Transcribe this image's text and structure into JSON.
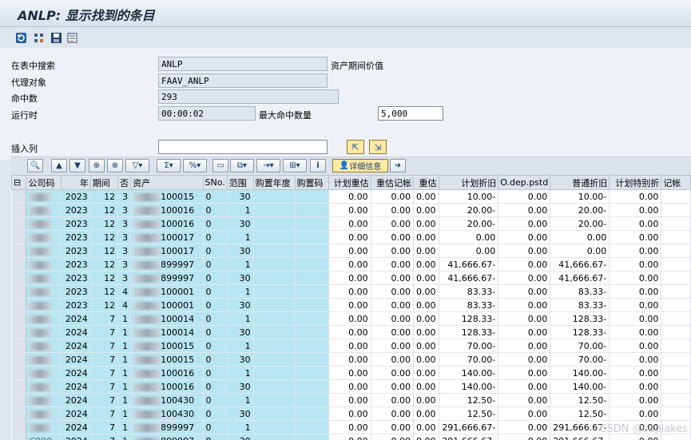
{
  "window": {
    "title": "ANLP: 显示找到的条目"
  },
  "toolbar": {
    "icons": [
      "refresh-icon",
      "settings-icon",
      "save-icon",
      "detail-icon"
    ]
  },
  "selection": {
    "search_table_label": "在表中搜索",
    "search_table_value": "ANLP",
    "search_table_desc": "资产期间价值",
    "proxy_label": "代理对象",
    "proxy_value": "FAAV_ANLP",
    "hits_label": "命中数",
    "hits_value": "293",
    "runtime_label": "运行时",
    "runtime_value": "00:00:02",
    "max_hits_label": "最大命中数量",
    "max_hits_value": "5,000",
    "insert_col_label": "插入列",
    "insert_col_value": ""
  },
  "alv_toolbar": {
    "detail_label": "详细信息"
  },
  "grid": {
    "headers": [
      "公司码",
      "年",
      "期间",
      "否",
      "资产",
      "SNo.",
      "范围",
      "购置年度",
      "购置码",
      "计划重估",
      "重估记帐",
      "重估",
      "计划折旧",
      "O.dep.pstd",
      "普通折旧",
      "计划特别折",
      "记帐"
    ],
    "rows": [
      [
        "",
        "2023",
        "12",
        "3",
        "100015",
        "0",
        "30",
        "",
        "",
        "0.00",
        "0.00",
        "0.00",
        "10.00-",
        "0.00",
        "10.00-",
        "0.00"
      ],
      [
        "",
        "2023",
        "12",
        "3",
        "100016",
        "0",
        "1",
        "",
        "",
        "0.00",
        "0.00",
        "0.00",
        "20.00-",
        "0.00",
        "20.00-",
        "0.00"
      ],
      [
        "",
        "2023",
        "12",
        "3",
        "100016",
        "0",
        "30",
        "",
        "",
        "0.00",
        "0.00",
        "0.00",
        "20.00-",
        "0.00",
        "20.00-",
        "0.00"
      ],
      [
        "",
        "2023",
        "12",
        "3",
        "100017",
        "0",
        "1",
        "",
        "",
        "0.00",
        "0.00",
        "0.00",
        "0.00",
        "0.00",
        "0.00",
        "0.00"
      ],
      [
        "",
        "2023",
        "12",
        "3",
        "100017",
        "0",
        "30",
        "",
        "",
        "0.00",
        "0.00",
        "0.00",
        "0.00",
        "0.00",
        "0.00",
        "0.00"
      ],
      [
        "",
        "2023",
        "12",
        "3",
        "899997",
        "0",
        "1",
        "",
        "",
        "0.00",
        "0.00",
        "0.00",
        "41,666.67-",
        "0.00",
        "41,666.67-",
        "0.00"
      ],
      [
        "",
        "2023",
        "12",
        "3",
        "899997",
        "0",
        "30",
        "",
        "",
        "0.00",
        "0.00",
        "0.00",
        "41,666.67-",
        "0.00",
        "41,666.67-",
        "0.00"
      ],
      [
        "",
        "2023",
        "12",
        "4",
        "100001",
        "0",
        "1",
        "",
        "",
        "0.00",
        "0.00",
        "0.00",
        "83.33-",
        "0.00",
        "83.33-",
        "0.00"
      ],
      [
        "",
        "2023",
        "12",
        "4",
        "100001",
        "0",
        "30",
        "",
        "",
        "0.00",
        "0.00",
        "0.00",
        "83.33-",
        "0.00",
        "83.33-",
        "0.00"
      ],
      [
        "",
        "2024",
        "7",
        "1",
        "100014",
        "0",
        "1",
        "",
        "",
        "0.00",
        "0.00",
        "0.00",
        "128.33-",
        "0.00",
        "128.33-",
        "0.00"
      ],
      [
        "",
        "2024",
        "7",
        "1",
        "100014",
        "0",
        "30",
        "",
        "",
        "0.00",
        "0.00",
        "0.00",
        "128.33-",
        "0.00",
        "128.33-",
        "0.00"
      ],
      [
        "",
        "2024",
        "7",
        "1",
        "100015",
        "0",
        "1",
        "",
        "",
        "0.00",
        "0.00",
        "0.00",
        "70.00-",
        "0.00",
        "70.00-",
        "0.00"
      ],
      [
        "",
        "2024",
        "7",
        "1",
        "100015",
        "0",
        "30",
        "",
        "",
        "0.00",
        "0.00",
        "0.00",
        "70.00-",
        "0.00",
        "70.00-",
        "0.00"
      ],
      [
        "",
        "2024",
        "7",
        "1",
        "100016",
        "0",
        "1",
        "",
        "",
        "0.00",
        "0.00",
        "0.00",
        "140.00-",
        "0.00",
        "140.00-",
        "0.00"
      ],
      [
        "",
        "2024",
        "7",
        "1",
        "100016",
        "0",
        "30",
        "",
        "",
        "0.00",
        "0.00",
        "0.00",
        "140.00-",
        "0.00",
        "140.00-",
        "0.00"
      ],
      [
        "",
        "2024",
        "7",
        "1",
        "100430",
        "0",
        "1",
        "",
        "",
        "0.00",
        "0.00",
        "0.00",
        "12.50-",
        "0.00",
        "12.50-",
        "0.00"
      ],
      [
        "",
        "2024",
        "7",
        "1",
        "100430",
        "0",
        "30",
        "",
        "",
        "0.00",
        "0.00",
        "0.00",
        "12.50-",
        "0.00",
        "12.50-",
        "0.00"
      ],
      [
        "",
        "2024",
        "7",
        "1",
        "899997",
        "0",
        "1",
        "",
        "",
        "0.00",
        "0.00",
        "0.00",
        "291,666.67-",
        "0.00",
        "291,666.67-",
        "0.00"
      ],
      [
        "C000",
        "2024",
        "7",
        "1",
        "899997",
        "0",
        "30",
        "",
        "",
        "0.00",
        "0.00",
        "0.00",
        "291,666.67-",
        "0.00",
        "291,666.67-",
        "0.00"
      ]
    ]
  },
  "watermark": "CSDN @saplakes"
}
